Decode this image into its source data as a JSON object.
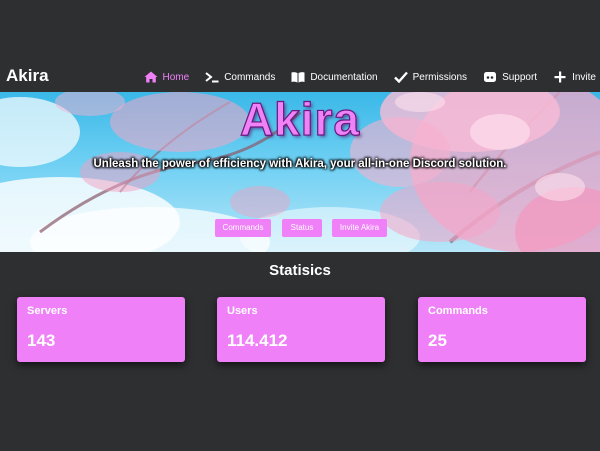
{
  "navbar": {
    "brand": "Akira",
    "links": [
      {
        "label": "Home",
        "icon": "home-icon",
        "active": true
      },
      {
        "label": "Commands",
        "icon": "terminal-icon"
      },
      {
        "label": "Documentation",
        "icon": "book-icon"
      },
      {
        "label": "Permissions",
        "icon": "check-icon"
      },
      {
        "label": "Support",
        "icon": "discord-icon"
      },
      {
        "label": "Invite",
        "icon": "plus-icon"
      }
    ]
  },
  "hero": {
    "title": "Akira",
    "subtitle": "Unleash the power of efficiency with Akira, your all-in-one Discord solution.",
    "buttons": [
      {
        "label": "Commands"
      },
      {
        "label": "Status"
      },
      {
        "label": "Invite Akira"
      }
    ]
  },
  "stats": {
    "title": "Statisics",
    "cards": [
      {
        "label": "Servers",
        "value": "143"
      },
      {
        "label": "Users",
        "value": "114.412"
      },
      {
        "label": "Commands",
        "value": "25"
      }
    ]
  },
  "colors": {
    "accent": "#f080f8",
    "background": "#2e2f31",
    "text": "#ffffff"
  }
}
